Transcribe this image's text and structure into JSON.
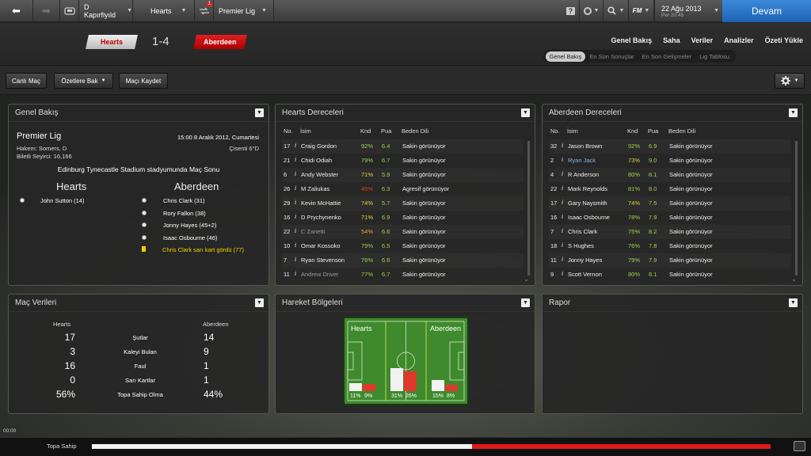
{
  "topbar": {
    "back": "⬅",
    "fwd": "➡",
    "club": "D Kapırfiyıld",
    "team": "Hearts",
    "badge": "1",
    "comp": "Premier Lig",
    "help": "?",
    "fm": "FM",
    "date": "22 Ağu 2013",
    "day": "Per 20:45",
    "continue": "Devam"
  },
  "header": {
    "home": "Hearts",
    "score": "1-4",
    "away": "Aberdeen",
    "tabs": [
      "Genel Bakış",
      "Saha",
      "Veriler",
      "Analizler",
      "Özeti Yükle"
    ],
    "subtabs": [
      "Genel Bakış",
      "En Son Sonuçlar",
      "En Son Gelişmeler",
      "Lig Tablosu"
    ]
  },
  "toolbar": {
    "live": "Canlı Maç",
    "highlights": "Özetlere Bak",
    "save": "Maçı Kaydet"
  },
  "overview": {
    "title": "Genel Bakış",
    "league": "Premier Lig",
    "when": "15:00 8 Aralık 2012, Cumartesi",
    "referee": "Hakem: Somers, D",
    "weather": "Çisenti 6°D",
    "attendance": "Biletli Seyirci: 16,166",
    "venue": "Edinburg Tynecastle Stadium stadyumunda Maç Sonu",
    "home": "Hearts",
    "away": "Aberdeen",
    "home_events": [
      {
        "text": "John Sutton (14)"
      }
    ],
    "away_events": [
      {
        "text": "Chris Clark (31)",
        "type": "goal"
      },
      {
        "text": "Rory Fallon (38)",
        "type": "goal"
      },
      {
        "text": "Jonny Hayes (45+2)",
        "type": "goal"
      },
      {
        "text": "Isaac Osbourne (46)",
        "type": "goal"
      },
      {
        "text": "Chris Clark sarı kart gördü (77)",
        "type": "card"
      }
    ]
  },
  "ratings_cols": {
    "no": "No.",
    "name": "İsim",
    "fit": "Knd",
    "rating": "Pua",
    "body": "Beden Dili",
    "info": "i"
  },
  "hearts_ratings": {
    "title": "Hearts Dereceleri",
    "players": [
      {
        "no": "17",
        "name": "Craig Gordon",
        "fit": "92%",
        "rating": "6.4",
        "body": "Sakin görünüyor"
      },
      {
        "no": "21",
        "name": "Chidi Odiah",
        "fit": "79%",
        "rating": "6.7",
        "body": "Sakin görünüyor"
      },
      {
        "no": "6",
        "name": "Andy Webster",
        "fit": "71%",
        "rating": "5.9",
        "body": "Sakin görünüyor"
      },
      {
        "no": "26",
        "name": "M Zaliukas",
        "fit": "45%",
        "rating": "6.3",
        "body": "Agresif görünüyor"
      },
      {
        "no": "29",
        "name": "Kevin McHattie",
        "fit": "74%",
        "rating": "5.7",
        "body": "Sakin görünüyor"
      },
      {
        "no": "16",
        "name": "D Prychynenko",
        "fit": "71%",
        "rating": "6.9",
        "body": "Sakin görünüyor"
      },
      {
        "no": "22",
        "name": "C Zanetti",
        "fit": "54%",
        "rating": "6.6",
        "body": "Sakin görünüyor"
      },
      {
        "no": "10",
        "name": "Omar Kossoko",
        "fit": "79%",
        "rating": "6.5",
        "body": "Sakin görünüyor"
      },
      {
        "no": "7",
        "name": "Ryan Stevenson",
        "fit": "76%",
        "rating": "6.6",
        "body": "Sakin görünüyor"
      },
      {
        "no": "11",
        "name": "Andrew Driver",
        "fit": "77%",
        "rating": "6.7",
        "body": "Sakin görünüyor"
      }
    ]
  },
  "aberdeen_ratings": {
    "title": "Aberdeen Dereceleri",
    "players": [
      {
        "no": "32",
        "name": "Jason Brown",
        "fit": "92%",
        "rating": "6.9",
        "body": "Sakin görünüyor"
      },
      {
        "no": "2",
        "name": "Ryan Jack",
        "fit": "73%",
        "rating": "9.0",
        "body": "Sakin görünüyor"
      },
      {
        "no": "4",
        "name": "R Anderson",
        "fit": "80%",
        "rating": "8.1",
        "body": "Sakin görünüyor"
      },
      {
        "no": "22",
        "name": "Mark Reynolds",
        "fit": "81%",
        "rating": "8.0",
        "body": "Sakin görünüyor"
      },
      {
        "no": "17",
        "name": "Gary Naysmith",
        "fit": "74%",
        "rating": "7.5",
        "body": "Sakin görünüyor"
      },
      {
        "no": "16",
        "name": "Isaac Osbourne",
        "fit": "78%",
        "rating": "7.9",
        "body": "Sakin görünüyor"
      },
      {
        "no": "7",
        "name": "Chris Clark",
        "fit": "75%",
        "rating": "8.2",
        "body": "Sakin görünüyor"
      },
      {
        "no": "18",
        "name": "S Hughes",
        "fit": "76%",
        "rating": "7.8",
        "body": "Sakin görünüyor"
      },
      {
        "no": "11",
        "name": "Jonny Hayes",
        "fit": "79%",
        "rating": "7.9",
        "body": "Sakin görünüyor"
      },
      {
        "no": "9",
        "name": "Scott Vernon",
        "fit": "80%",
        "rating": "8.1",
        "body": "Sakin görünüyor"
      }
    ]
  },
  "stats": {
    "title": "Maç Verileri",
    "home": "Hearts",
    "away": "Aberdeen",
    "rows": [
      {
        "label": "Şutlar",
        "home": "17",
        "away": "14"
      },
      {
        "label": "Kaleyi Bulan",
        "home": "3",
        "away": "9"
      },
      {
        "label": "Faul",
        "home": "16",
        "away": "1"
      },
      {
        "label": "Sarı Kartlar",
        "home": "0",
        "away": "1"
      },
      {
        "label": "Topa Sahip Olma",
        "home": "56%",
        "away": "44%"
      }
    ]
  },
  "zones": {
    "title": "Hareket Bölgeleri",
    "home": "Hearts",
    "away": "Aberdeen",
    "thirds": [
      {
        "home": "11%",
        "away": "9%",
        "home_v": 11,
        "away_v": 9
      },
      {
        "home": "31%",
        "away": "26%",
        "home_v": 31,
        "away_v": 26
      },
      {
        "home": "15%",
        "away": "8%",
        "home_v": 15,
        "away_v": 8
      }
    ]
  },
  "report": {
    "title": "Rapor"
  },
  "bottom": {
    "time": "00:00",
    "possession_label": "Topa Sahip",
    "home_possession": 0.56
  },
  "colors": {
    "accent": "#1e62b3",
    "green": "#9fd24a",
    "yellow": "#e8d23a",
    "red": "#e0382c",
    "pitch": "#3e8a2c"
  }
}
